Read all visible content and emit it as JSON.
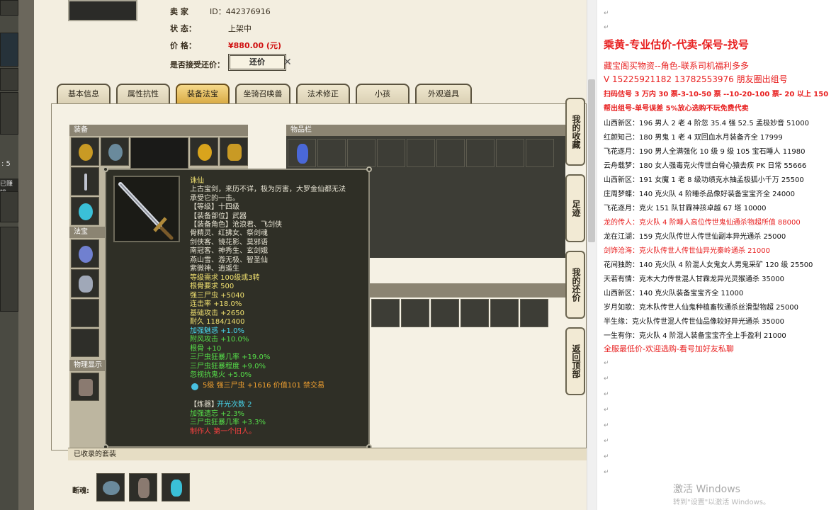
{
  "seller_info": {
    "seller_label": "卖 家",
    "seller_value": "ID：442376916",
    "status_label": "状 态：",
    "status_value": "上架中",
    "price_label": "价 格：",
    "price_value": "¥880.00 (元)",
    "haggle_label": "是否接受还价：",
    "haggle_button": "还价"
  },
  "left_strip": {
    "partial_a": ": 5",
    "partial_b": "已赚钱"
  },
  "tabs": [
    "基本信息",
    "属性抗性",
    "装备法宝",
    "坐骑召唤兽",
    "法术修正",
    "小孩",
    "外观道具"
  ],
  "active_tab": "装备法宝",
  "sections": {
    "equipment": "装备",
    "inventory": "物品栏",
    "treasure": "法宝",
    "bottom_left": "物理显示",
    "collected_sets": "已收录的套装",
    "set_owner": "断魂:"
  },
  "side_nav": [
    "我的收藏",
    "足迹",
    "我的还价",
    "返回顶部"
  ],
  "tooltip": {
    "name": "诛仙",
    "desc1": "上古宝剑，来历不详，极为厉害，大罗金仙都无法",
    "desc2": "承受它的一击。",
    "grade": "【等级】十四级",
    "slot": "【装备部位】武器",
    "roles1": "【装备角色】沧浪君、飞剑侠",
    "roles2": "骨精灵、红拂女、祭剑魂",
    "roles3": "剑侠客、镜花影、莫邪语",
    "roles4": "南冠客、神秀生、玄剑娥",
    "roles5": "燕山雪、游无极、智圣仙",
    "roles6": "紫微神、逍遥生",
    "req_level": "等级需求 100级或3转",
    "req_bone": "根骨要求 500",
    "stat1": "强三尸虫 +5040",
    "stat2": "连击率 +18.0%",
    "stat3": "基础攻击 +2650",
    "stat4": "耐久 1184/1400",
    "bonus1": "加强魅惑 +1.0%",
    "bonus2": "附风攻击 +10.0%",
    "bonus3": "根骨 +10",
    "bonus4": "三尸虫狂暴几率 +19.0%",
    "bonus5": "三尸虫狂暴程度 +9.0%",
    "bonus6": "忽视抗鬼火 +5.0%",
    "gem_line": "5级 强三尸虫 +1616 价值101 禁交易",
    "refine_title": "【炼器】",
    "refine_count": "开光次数 2",
    "refine1": "加强遗忘 +2.3%",
    "refine2": "三尸虫狂暴几率 +3.3%",
    "maker": "制作人 第一个旧人。"
  },
  "doc": {
    "headline": "乘黄-专业估价-代卖-保号-找号",
    "line1": "藏宝阁买物资--角色-联系司机福利多多",
    "line2": "V 15225921182   13782553976 朋友圈出组号",
    "line3": "扫码估号 3 万内 30 票-3-10-50 票  --10-20-100 票- 20 以上 150",
    "line4": "帮出组号-单号误差 5%放心选购不玩免费代卖",
    "listings": [
      {
        "text": "山西新区：196 男人 2 老 4 阶忽 35.4 强 52.5 孟极妙音 51000",
        "color": "#111111"
      },
      {
        "text": "红颜知己：180 男鬼 1 老 4 双回血水月装备齐全 17999",
        "color": "#111111"
      },
      {
        "text": "飞花逐月：190 男人全满强化 10 级 9 级 105 宝石睡人 11980",
        "color": "#111111"
      },
      {
        "text": "云舟载梦：180 女人强毒克火传世白骨心猿去疾 PK 日常 55666",
        "color": "#111111"
      },
      {
        "text": "山西新区：191 女魔 1 老 8 级功绩克水抽孟极狐小千万 25500",
        "color": "#111111"
      },
      {
        "text": "庄周梦蝶：140 克火队 4 阶睡杀品像好装备宝宝齐全 24000",
        "color": "#111111"
      },
      {
        "text": "飞花逐月：克火 151 队甘霖神孩卓越 67 塔 10000",
        "color": "#111111"
      },
      {
        "text": "龙的传人：克火队 4 阶睡人高位传世鬼仙通杀物超所值 88000",
        "color": "#e82020"
      },
      {
        "text": "龙在江湖：159 克火队传世人传世仙副本异光通杀 25000",
        "color": "#111111"
      },
      {
        "text": "剑饰沧海：克火队传世人传世仙异光秦岭通杀 21000",
        "color": "#e82020"
      },
      {
        "text": "花间独酌：140 克火队 4 阶混人女鬼女人男鬼采矿 120 级 25500",
        "color": "#111111"
      },
      {
        "text": "天若有情：克木大力传世混人甘霖龙异光灵猴通杀 35000",
        "color": "#111111"
      },
      {
        "text": "山西新区：140 克火队装备宝宝齐全 11000",
        "color": "#111111"
      },
      {
        "text": "岁月如歌：克木队传世人仙鬼种植畜牧通杀丝滑型物超 25000",
        "color": "#111111"
      },
      {
        "text": "半生缘：克火队传世混人传世仙品像较好异光通杀 35000",
        "color": "#111111"
      },
      {
        "text": "一生有你：克火队 4 阶混人装备宝宝齐全上手盈利 21000",
        "color": "#111111"
      }
    ],
    "closing": "全服最低价-欢迎选购-看号加好友私聊",
    "watermark1": "激活 Windows",
    "watermark2": "转到\"设置\"以激活 Windows。"
  },
  "colors": {
    "accent_red": "#e82020",
    "price_red": "#d01010",
    "tab_active": "#d7a840",
    "tooltip_bg": "#2f2f26"
  }
}
